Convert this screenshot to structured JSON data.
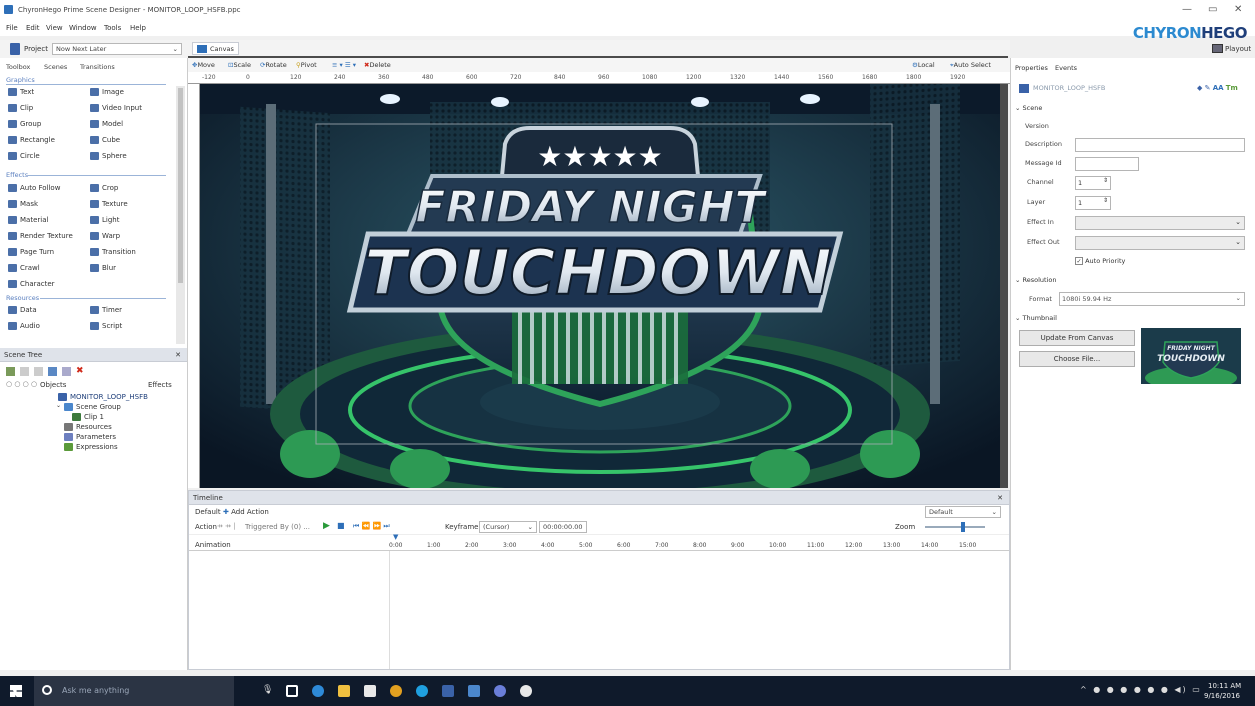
{
  "window": {
    "title": "ChyronHego Prime Scene Designer - MONITOR_LOOP_HSFB.ppc"
  },
  "menu": [
    "File",
    "Edit",
    "View",
    "Window",
    "Tools",
    "Help"
  ],
  "brand": {
    "logo_part1": "CHYRON",
    "logo_part2": "HEGO",
    "color1": "#2c8ad0",
    "color2": "#1f3f7a",
    "playout_label": "Playout"
  },
  "project": {
    "label": "Project",
    "value": "Now Next Later"
  },
  "toolbox": {
    "tabs": [
      "Toolbox",
      "Scenes",
      "Transitions"
    ],
    "graphics_header": "Graphics",
    "graphics": [
      {
        "label": "Text",
        "icon": "text-icon"
      },
      {
        "label": "Image",
        "icon": "image-icon"
      },
      {
        "label": "Clip",
        "icon": "clip-icon"
      },
      {
        "label": "Video Input",
        "icon": "video-input-icon"
      },
      {
        "label": "Group",
        "icon": "group-icon"
      },
      {
        "label": "Model",
        "icon": "model-icon"
      },
      {
        "label": "Rectangle",
        "icon": "rectangle-icon"
      },
      {
        "label": "Cube",
        "icon": "cube-icon"
      },
      {
        "label": "Circle",
        "icon": "circle-icon"
      },
      {
        "label": "Sphere",
        "icon": "sphere-icon"
      }
    ],
    "effects_header": "Effects",
    "effects": [
      {
        "label": "Auto Follow",
        "icon": "auto-follow-icon"
      },
      {
        "label": "Crop",
        "icon": "crop-icon"
      },
      {
        "label": "Mask",
        "icon": "mask-icon"
      },
      {
        "label": "Texture",
        "icon": "texture-icon"
      },
      {
        "label": "Material",
        "icon": "material-icon"
      },
      {
        "label": "Light",
        "icon": "light-icon"
      },
      {
        "label": "Render Texture",
        "icon": "render-texture-icon"
      },
      {
        "label": "Warp",
        "icon": "warp-icon"
      },
      {
        "label": "Page Turn",
        "icon": "page-turn-icon"
      },
      {
        "label": "Transition",
        "icon": "transition-icon"
      },
      {
        "label": "Crawl",
        "icon": "crawl-icon"
      },
      {
        "label": "Blur",
        "icon": "blur-icon"
      },
      {
        "label": "Character",
        "icon": "character-icon"
      }
    ],
    "resources_header": "Resources",
    "resources": [
      {
        "label": "Data",
        "icon": "data-icon"
      },
      {
        "label": "Timer",
        "icon": "timer-icon"
      },
      {
        "label": "Audio",
        "icon": "audio-icon"
      },
      {
        "label": "Script",
        "icon": "script-icon"
      }
    ]
  },
  "scene_tree": {
    "title": "Scene Tree",
    "col_objects": "Objects",
    "col_effects": "Effects",
    "items": [
      "MONITOR_LOOP_HSFB",
      "Scene Group",
      "Clip 1",
      "Resources",
      "Parameters",
      "Expressions"
    ]
  },
  "canvas": {
    "tab": "Canvas",
    "tools": [
      "Move",
      "Scale",
      "Rotate",
      "Pivot",
      "Delete"
    ],
    "right_tools": [
      "Local",
      "Auto Select"
    ],
    "ruler_ticks": [
      "-120",
      "0",
      "120",
      "240",
      "360",
      "480",
      "600",
      "720",
      "840",
      "960",
      "1080",
      "1200",
      "1320",
      "1440",
      "1560",
      "1680",
      "1800",
      "1920"
    ],
    "graphic": {
      "line1": "FRIDAY NIGHT",
      "line2": "TOUCHDOWN",
      "stars": "★★★★★"
    }
  },
  "timeline": {
    "title": "Timeline",
    "preset": "Default",
    "add_action": "Add Action",
    "action_label": "Action",
    "triggered": "Triggered By (0) ...",
    "keyframe_label": "Keyframe",
    "keyframe_value": "(Cursor)",
    "time_value": "00:00:00.00",
    "zoom_label": "Zoom",
    "default_right": "Default",
    "track": "Animation",
    "ticks": [
      "0:00",
      "1:00",
      "2:00",
      "3:00",
      "4:00",
      "5:00",
      "6:00",
      "7:00",
      "8:00",
      "9:00",
      "10:00",
      "11:00",
      "12:00",
      "13:00",
      "14:00",
      "15:00"
    ]
  },
  "properties": {
    "tabs": [
      "Properties",
      "Events"
    ],
    "object_name": "MONITOR_LOOP_HSFB",
    "scene_header": "Scene",
    "fields": {
      "version": "Version",
      "description": "Description",
      "message_id": "Message Id",
      "channel": "Channel",
      "channel_value": "1",
      "layer": "Layer",
      "layer_value": "1",
      "effect_in": "Effect In",
      "effect_out": "Effect Out",
      "auto_priority": "Auto Priority"
    },
    "resolution_header": "Resolution",
    "format_label": "Format",
    "format_value": "1080i 59.94 Hz",
    "thumbnail_header": "Thumbnail",
    "update_btn": "Update From Canvas",
    "choose_btn": "Choose File...",
    "thumb_line1": "FRIDAY NIGHT",
    "thumb_line2": "TOUCHDOWN"
  },
  "taskbar": {
    "search": "Ask me anything",
    "time": "10:11 AM",
    "date": "9/16/2016"
  }
}
